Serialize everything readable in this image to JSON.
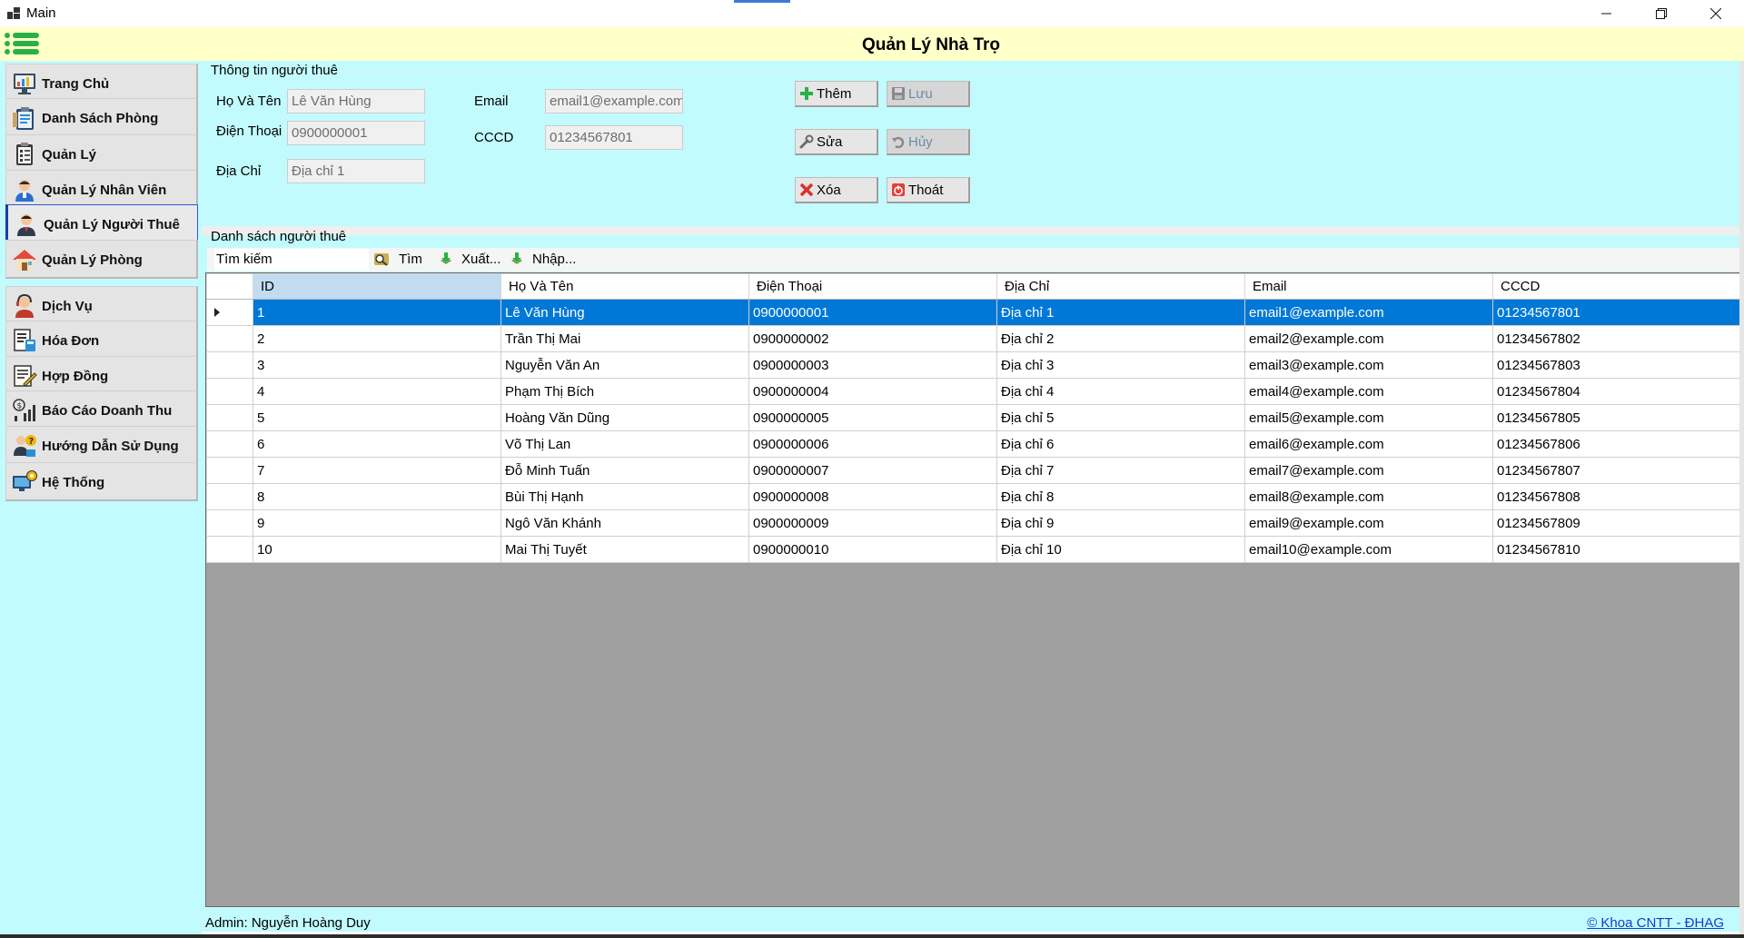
{
  "window": {
    "title": "Main",
    "min_icon": "minimize-icon",
    "max_icon": "restore-icon",
    "close_icon": "close-icon"
  },
  "header": {
    "title": "Quản Lý Nhà Trọ",
    "menu_icon": "hamburger-menu-icon"
  },
  "sidebar": {
    "items": [
      {
        "label": "Trang Chủ",
        "icon": "dashboard-icon"
      },
      {
        "label": "Danh Sách Phòng",
        "icon": "clipboard-list-icon"
      },
      {
        "label": "Quản Lý",
        "icon": "checklist-icon"
      },
      {
        "label": "Quản Lý Nhân Viên",
        "icon": "employee-icon"
      },
      {
        "label": "Quản Lý Người Thuê",
        "icon": "tenant-icon",
        "active": true
      },
      {
        "label": "Quản Lý Phòng",
        "icon": "house-icon"
      },
      {
        "label": "Dịch Vụ",
        "icon": "service-agent-icon"
      },
      {
        "label": "Hóa Đơn",
        "icon": "invoice-icon"
      },
      {
        "label": "Hợp Đồng",
        "icon": "contract-icon"
      },
      {
        "label": "Báo Cáo Doanh Thu",
        "icon": "revenue-chart-icon"
      },
      {
        "label": "Hướng Dẫn Sử Dụng",
        "icon": "user-guide-icon"
      },
      {
        "label": "Hệ Thống",
        "icon": "system-settings-icon"
      }
    ]
  },
  "tenant_info": {
    "legend": "Thông tin người thuê",
    "name_label": "Họ Và Tên",
    "name_value": "Lê Văn Hùng",
    "phone_label": "Điện Thoại",
    "phone_value": "0900000001",
    "address_label": "Địa Chỉ",
    "address_value": "Địa chỉ 1",
    "email_label": "Email",
    "email_value": "email1@example.com",
    "cccd_label": "CCCD",
    "cccd_value": "01234567801"
  },
  "actions": {
    "add": "Thêm",
    "save": "Lưu",
    "edit": "Sửa",
    "cancel": "Hủy",
    "delete": "Xóa",
    "exit": "Thoát"
  },
  "list": {
    "legend": "Danh sách người thuê",
    "search_placeholder": "Tìm kiếm",
    "find": "Tìm",
    "export": "Xuất...",
    "import": "Nhập...",
    "columns": [
      "ID",
      "Họ Và Tên",
      "Điện Thoại",
      "Địa Chỉ",
      "Email",
      "CCCD"
    ],
    "rows": [
      [
        "1",
        "Lê Văn Hùng",
        "0900000001",
        "Địa chỉ 1",
        "email1@example.com",
        "01234567801"
      ],
      [
        "2",
        "Trần Thị Mai",
        "0900000002",
        "Địa chỉ 2",
        "email2@example.com",
        "01234567802"
      ],
      [
        "3",
        "Nguyễn Văn An",
        "0900000003",
        "Địa chỉ 3",
        "email3@example.com",
        "01234567803"
      ],
      [
        "4",
        "Phạm Thị Bích",
        "0900000004",
        "Địa chỉ 4",
        "email4@example.com",
        "01234567804"
      ],
      [
        "5",
        "Hoàng Văn Dũng",
        "0900000005",
        "Địa chỉ 5",
        "email5@example.com",
        "01234567805"
      ],
      [
        "6",
        "Võ Thị Lan",
        "0900000006",
        "Địa chỉ 6",
        "email6@example.com",
        "01234567806"
      ],
      [
        "7",
        "Đỗ Minh Tuấn",
        "0900000007",
        "Địa chỉ 7",
        "email7@example.com",
        "01234567807"
      ],
      [
        "8",
        "Bùi Thị Hạnh",
        "0900000008",
        "Địa chỉ 8",
        "email8@example.com",
        "01234567808"
      ],
      [
        "9",
        "Ngô Văn Khánh",
        "0900000009",
        "Địa chỉ 9",
        "email9@example.com",
        "01234567809"
      ],
      [
        "10",
        "Mai Thị Tuyết",
        "0900000010",
        "Địa chỉ 10",
        "email10@example.com",
        "01234567810"
      ]
    ]
  },
  "status": {
    "admin": "Admin: Nguyễn Hoàng Duy",
    "credit": "© Khoa CNTT - ĐHAG"
  },
  "colors": {
    "header_bg": "#ffffc8",
    "panel_bg": "#c2fbfe",
    "selection": "#0078d7",
    "credit_link": "#1a38d6"
  }
}
